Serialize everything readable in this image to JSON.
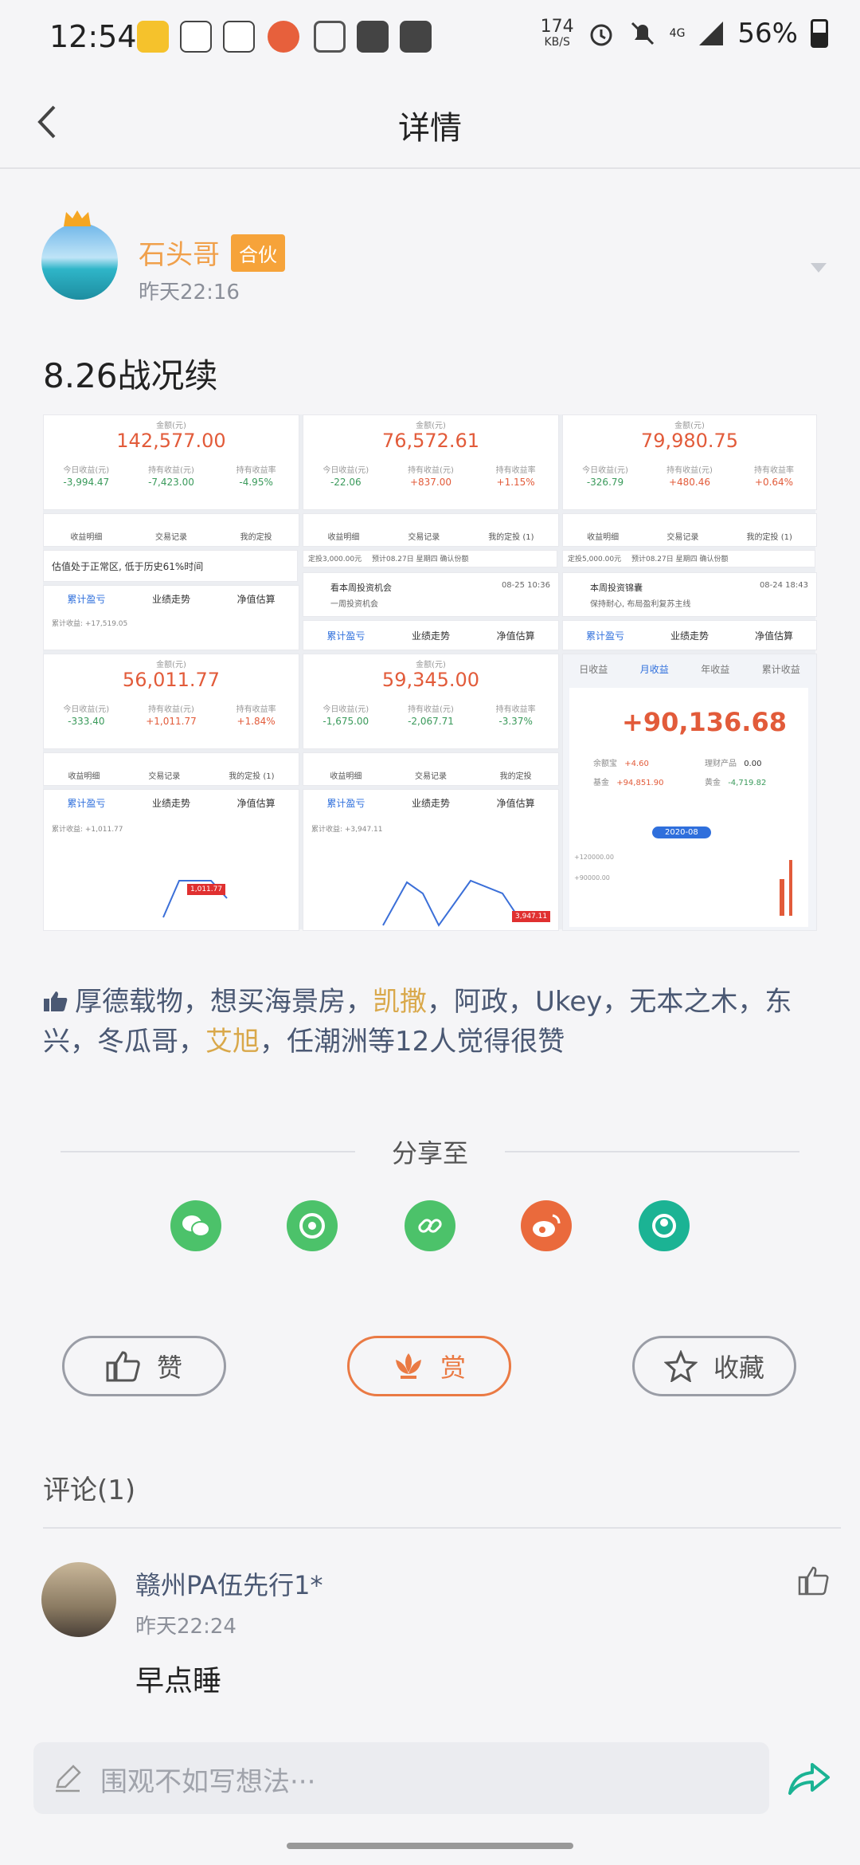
{
  "status_bar": {
    "time": "12:54",
    "speed_value": "174",
    "speed_unit": "KB/S",
    "network": "4G",
    "battery": "56%"
  },
  "header": {
    "title": "详情"
  },
  "post": {
    "author": "石头哥",
    "badge": "合伙",
    "time": "昨天22:16",
    "title": "8.26战况续"
  },
  "screenshots": {
    "amount_label": "金额(元)",
    "labels": {
      "today": "今日收益(元)",
      "hold": "持有收益(元)",
      "rate": "持有收益率"
    },
    "cards": [
      {
        "amount": "142,577.00",
        "today": "-3,994.47",
        "hold": "-7,423.00",
        "rate": "-4.95%"
      },
      {
        "amount": "76,572.61",
        "today": "-22.06",
        "hold": "+837.00",
        "rate": "+1.15%"
      },
      {
        "amount": "79,980.75",
        "today": "-326.79",
        "hold": "+480.46",
        "rate": "+0.64%"
      },
      {
        "amount": "56,011.77",
        "today": "-333.40",
        "hold": "+1,011.77",
        "rate": "+1.84%"
      },
      {
        "amount": "59,345.00",
        "today": "-1,675.00",
        "hold": "-2,067.71",
        "rate": "-3.37%"
      }
    ],
    "mini_menu": [
      "收益明细",
      "交易记录",
      "我的定投"
    ],
    "mini_menu_alt": [
      "收益明细",
      "交易记录",
      "我的定投 (1)"
    ],
    "tabs": [
      "累计盈亏",
      "业绩走势",
      "净值估算"
    ],
    "notice": "估值处于正常区, 低于历史61%时间",
    "invest1": {
      "title": "看本周投资机会",
      "sub": "一周投资机会",
      "date": "08-25 10:36",
      "plan": "定投3,000.00元",
      "plan_note": "预计08.27日 星期四 确认份额"
    },
    "invest2": {
      "title": "本周投资锦囊",
      "sub": "保持耐心, 布局盈利复苏主线",
      "date": "08-24 18:43",
      "plan": "定投5,000.00元",
      "plan_note": "预计08.27日 星期四 确认份额"
    },
    "cum1": "累计收益: +17,519.05",
    "cum2": "累计收益: +1,011.77",
    "cum3": "累计收益: +3,947.11",
    "chart_tag1": "1,011.77",
    "chart_tag2": "3,947.11",
    "summary": {
      "tabs": [
        "日收益",
        "月收益",
        "年收益",
        "累计收益"
      ],
      "total": "+90,136.68",
      "rows": [
        {
          "k": "余额宝",
          "v": "+4.60"
        },
        {
          "k": "理财产品",
          "v": "0.00"
        },
        {
          "k": "基金",
          "v": "+94,851.90"
        },
        {
          "k": "黄金",
          "v": "-4,719.82"
        }
      ],
      "month": "2020-08",
      "y1": "+120000.00",
      "y2": "+90000.00"
    }
  },
  "likes": {
    "names_a": "厚德载物，想买海景房，",
    "gold1": "凯撒",
    "names_b": "，阿政，Ukey，无本之木，东兴，冬瓜哥，",
    "gold2": "艾旭",
    "names_c": "，任潮洲等12人觉得很赞"
  },
  "share": {
    "label": "分享至",
    "icons": [
      "wechat-icon",
      "moments-icon",
      "link-icon",
      "weibo-icon",
      "qq-icon"
    ]
  },
  "actions": {
    "like": "赞",
    "reward": "赏",
    "collect": "收藏"
  },
  "comments": {
    "title": "评论(1)",
    "items": [
      {
        "name": "赣州PA伍先行1*",
        "time": "昨天22:24",
        "text": "早点睡"
      }
    ]
  },
  "composer": {
    "placeholder": "围观不如写想法···"
  },
  "colors": {
    "orange": "#f0a04b",
    "green": "#4cc26a",
    "teal": "#1bb394",
    "weibo": "#ea6a3c",
    "link_blue": "#4a5873"
  }
}
